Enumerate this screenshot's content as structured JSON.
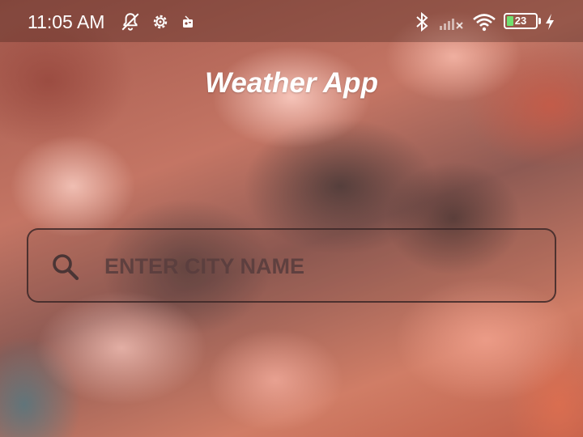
{
  "status_bar": {
    "time": "11:05 AM",
    "battery_level": "23",
    "icons": [
      "notifications-off-icon",
      "settings-icon",
      "radio-icon",
      "bluetooth-icon",
      "signal-off-icon",
      "wifi-icon",
      "battery-icon",
      "charging-icon"
    ]
  },
  "app": {
    "title": "Weather App"
  },
  "search": {
    "placeholder": "ENTER CITY NAME",
    "value": "",
    "icon": "search-icon"
  },
  "colors": {
    "text": "#ffffff",
    "input_text": "#5a3e3e",
    "border": "#3c2828",
    "battery": "#6fe06f"
  }
}
